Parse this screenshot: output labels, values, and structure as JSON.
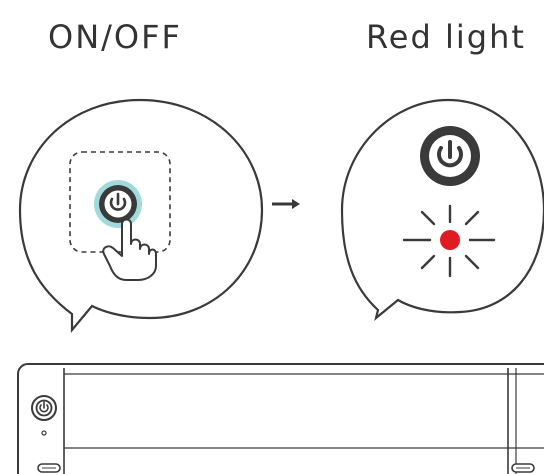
{
  "labels": {
    "left": "ON/OFF",
    "right": "Red light"
  },
  "colors": {
    "stroke": "#3a3a3a",
    "button_glow": "#8fd3d6",
    "red_light": "#e11b22",
    "background": "#ffffff"
  },
  "icons": {
    "left_bubble": [
      "power-icon",
      "pointing-hand-icon"
    ],
    "right_bubble": [
      "power-icon",
      "red-light-icon"
    ],
    "between": "arrow-right-icon",
    "device": [
      "power-icon"
    ]
  }
}
